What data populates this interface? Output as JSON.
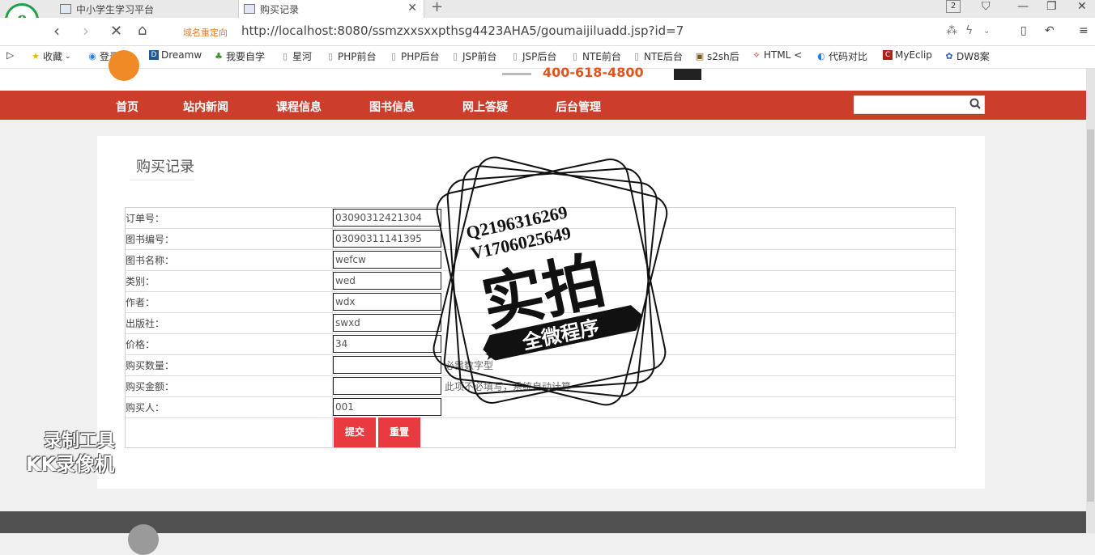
{
  "browser": {
    "tabs": [
      {
        "label": "中小学生学习平台"
      },
      {
        "label": "购买记录"
      }
    ],
    "tab_count": "2",
    "redirect_label": "域名重定向",
    "url": "http://localhost:8080/ssmzxxsxxpthsg4423AHA5/goumaijiluadd.jsp?id=7",
    "bookmarks": [
      {
        "label": "收藏",
        "icon": "star-icon"
      },
      {
        "label": "登录QQ",
        "icon": "qq-icon"
      },
      {
        "label": "Dreamw",
        "icon": "dreamweaver-icon"
      },
      {
        "label": "我要自学",
        "icon": "leaf-icon"
      },
      {
        "label": "星河",
        "icon": "page-icon"
      },
      {
        "label": "PHP前台",
        "icon": "page-icon"
      },
      {
        "label": "PHP后台",
        "icon": "page-icon"
      },
      {
        "label": "JSP前台",
        "icon": "page-icon"
      },
      {
        "label": "JSP后台",
        "icon": "page-icon"
      },
      {
        "label": "NTE前台",
        "icon": "page-icon"
      },
      {
        "label": "NTE后台",
        "icon": "page-icon"
      },
      {
        "label": "s2sh后",
        "icon": "image-icon"
      },
      {
        "label": "HTML <",
        "icon": "html-icon"
      },
      {
        "label": "代码对比",
        "icon": "compare-icon"
      },
      {
        "label": "MyEclip",
        "icon": "myeclipse-icon"
      },
      {
        "label": "DW8案",
        "icon": "paw-icon"
      }
    ]
  },
  "site": {
    "hotline": "400-618-4800",
    "nav": [
      "首页",
      "站内新闻",
      "课程信息",
      "图书信息",
      "网上答疑",
      "后台管理"
    ]
  },
  "form": {
    "title": "购买记录",
    "fields": [
      {
        "label": "订单号：",
        "value": "03090312421304",
        "hint": ""
      },
      {
        "label": "图书编号：",
        "value": "03090311141395",
        "hint": ""
      },
      {
        "label": "图书名称：",
        "value": "wefcw",
        "hint": ""
      },
      {
        "label": "类别：",
        "value": "wed",
        "hint": ""
      },
      {
        "label": "作者：",
        "value": "wdx",
        "hint": ""
      },
      {
        "label": "出版社：",
        "value": "swxd",
        "hint": ""
      },
      {
        "label": "价格：",
        "value": "34",
        "hint": ""
      },
      {
        "label": "购买数量：",
        "value": "",
        "hint": "必需数字型"
      },
      {
        "label": "购买金额：",
        "value": "",
        "hint": "此项不必填写，系统自动计算"
      },
      {
        "label": "购买人：",
        "value": "001",
        "hint": ""
      }
    ],
    "submit_label": "提交",
    "reset_label": "重置"
  },
  "watermark": {
    "recorder_line1": "录制工具",
    "recorder_line2": "KK录像机",
    "stamp_qq": "Q2196316269",
    "stamp_v": "V1706025649",
    "stamp_main": "实拍",
    "stamp_ribbon": "全微程序"
  }
}
